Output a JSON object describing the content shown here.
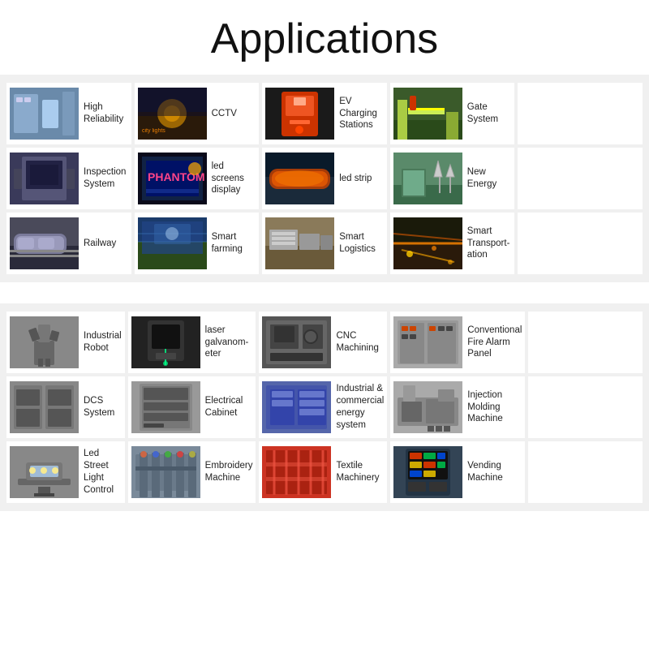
{
  "page": {
    "title": "Applications"
  },
  "sections": [
    {
      "id": "top-apps",
      "items": [
        {
          "label": "High Reliability",
          "color": "#5a7a9a",
          "color2": "#3a5a7a"
        },
        {
          "label": "CCTV",
          "color": "#c47a2a",
          "color2": "#8a4a10"
        },
        {
          "label": "EV Charging Stations",
          "color": "#cc4422",
          "color2": "#992200"
        },
        {
          "label": "Gate System",
          "color": "#4a7a3a",
          "color2": "#2a5a1a"
        },
        {
          "label": "",
          "color": "#777",
          "color2": "#555"
        },
        {
          "label": "Inspection System",
          "color": "#4a4a6a",
          "color2": "#2a2a4a"
        },
        {
          "label": "led screens display",
          "color": "#2244aa",
          "color2": "#1122aa"
        },
        {
          "label": "led strip",
          "color": "#1a3a6a",
          "color2": "#0a1a4a"
        },
        {
          "label": "New Energy",
          "color": "#3a7a4a",
          "color2": "#1a5a2a"
        },
        {
          "label": "",
          "color": "#777",
          "color2": "#555"
        },
        {
          "label": "Railway",
          "color": "#7a7a8a",
          "color2": "#4a4a5a"
        },
        {
          "label": "Smart farming",
          "color": "#2266aa",
          "color2": "#1144aa"
        },
        {
          "label": "Smart Logistics",
          "color": "#7a6a4a",
          "color2": "#5a4a2a"
        },
        {
          "label": "Smart Transport-ation",
          "color": "#cc7700",
          "color2": "#aa5500"
        },
        {
          "label": "",
          "color": "#777",
          "color2": "#555"
        }
      ]
    },
    {
      "id": "industrial-apps",
      "items": [
        {
          "label": "Industrial Robot",
          "color": "#888",
          "color2": "#555"
        },
        {
          "label": "laser galvanom-eter",
          "color": "#333",
          "color2": "#111"
        },
        {
          "label": "CNC Machining",
          "color": "#555",
          "color2": "#333"
        },
        {
          "label": "Conventional Fire Alarm Panel",
          "color": "#aaa",
          "color2": "#777"
        },
        {
          "label": "",
          "color": "#777",
          "color2": "#555"
        },
        {
          "label": "DCS System",
          "color": "#888",
          "color2": "#555"
        },
        {
          "label": "Electrical Cabinet",
          "color": "#999",
          "color2": "#666"
        },
        {
          "label": "Industrial & commercial energy system",
          "color": "#5566aa",
          "color2": "#334488"
        },
        {
          "label": "Injection Molding Machine",
          "color": "#aaa",
          "color2": "#777"
        },
        {
          "label": "",
          "color": "#777",
          "color2": "#555"
        },
        {
          "label": "Led Street Light Control",
          "color": "#888",
          "color2": "#555"
        },
        {
          "label": "Embroidery Machine",
          "color": "#7a8a9a",
          "color2": "#4a5a6a"
        },
        {
          "label": "Textile Machinery",
          "color": "#cc3322",
          "color2": "#aa1100"
        },
        {
          "label": "Vending Machine",
          "color": "#334455",
          "color2": "#112233"
        },
        {
          "label": "",
          "color": "#777",
          "color2": "#555"
        }
      ]
    }
  ],
  "colors": {
    "c1": "#5a7a9a",
    "c2": "#c47a2a",
    "c3": "#cc4422",
    "c4": "#4a7a3a",
    "c5": "#4a4a6a",
    "c6": "#2244aa",
    "c7": "#1a3a6a",
    "c8": "#3a7a4a",
    "c9": "#7a7a8a",
    "c10": "#2266aa",
    "c11": "#7a6a4a",
    "c12": "#cc7700"
  }
}
